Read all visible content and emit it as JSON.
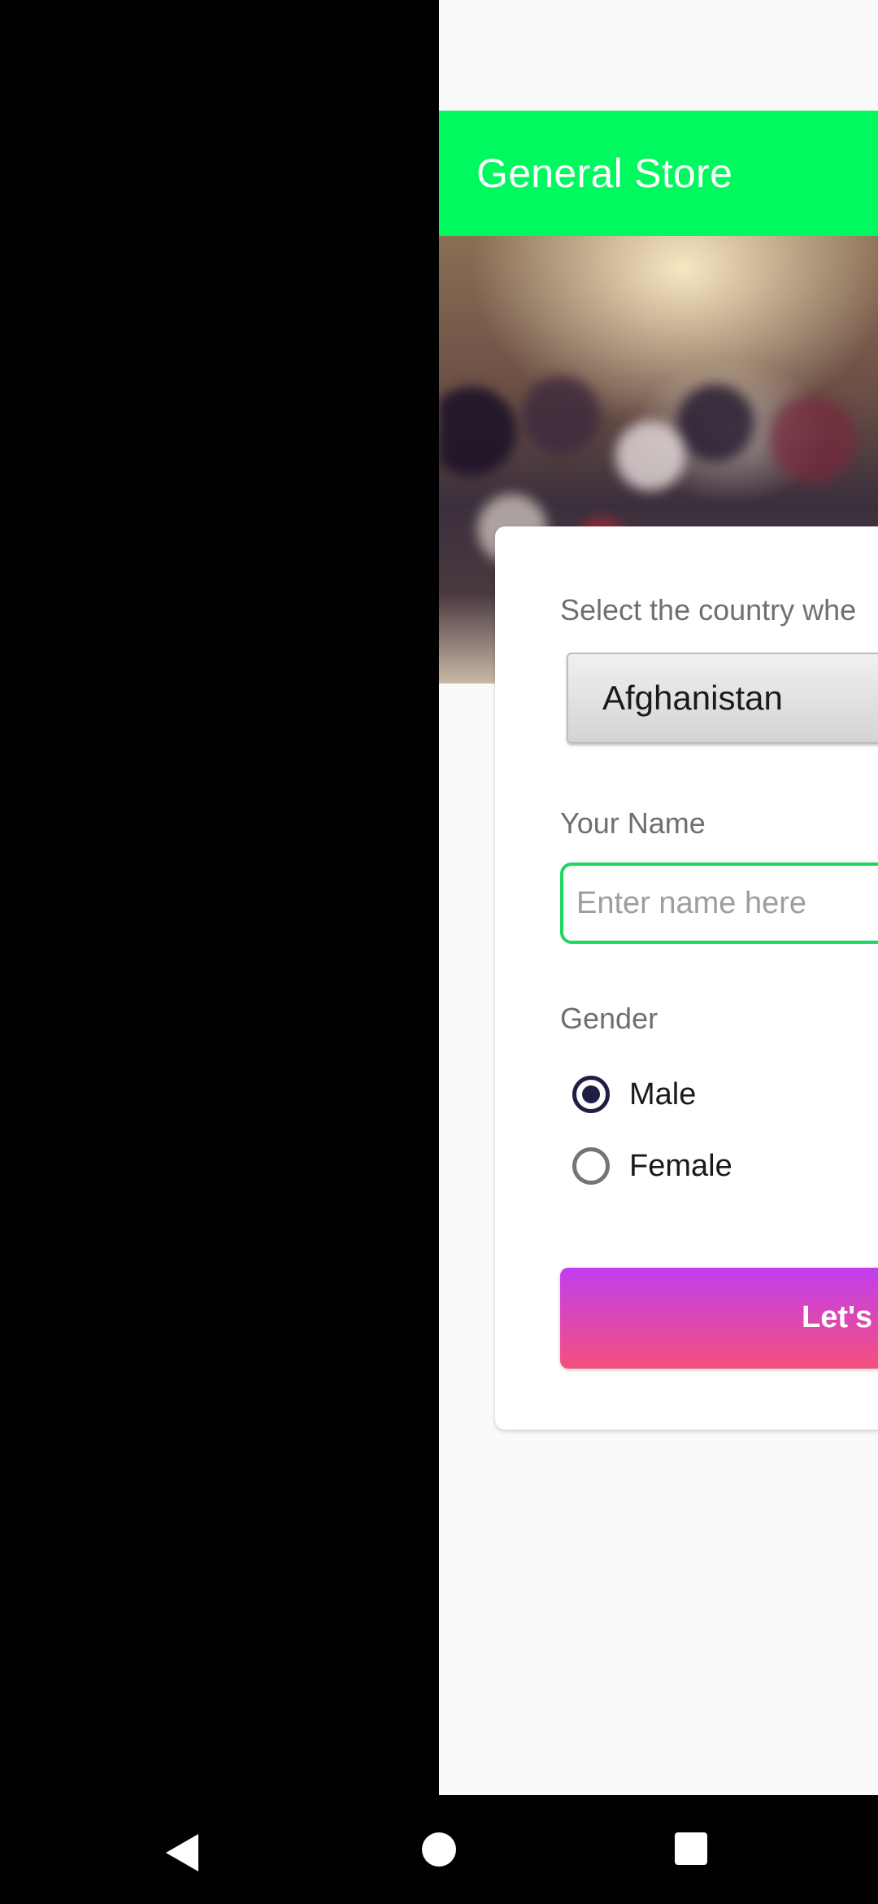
{
  "app_bar": {
    "title": "General Store",
    "color": "#00f95f"
  },
  "form": {
    "country_label": "Select the country whe",
    "country_selected": "Afghanistan",
    "name_label": "Your Name",
    "name_placeholder": "Enter name here",
    "name_value": "",
    "gender_label": "Gender",
    "gender_options": [
      {
        "label": "Male",
        "selected": true
      },
      {
        "label": "Female",
        "selected": false
      }
    ],
    "submit_label": "Let's"
  },
  "navigation": {
    "back_icon": "back-triangle-icon",
    "home_icon": "home-circle-icon",
    "recents_icon": "recents-square-icon"
  }
}
